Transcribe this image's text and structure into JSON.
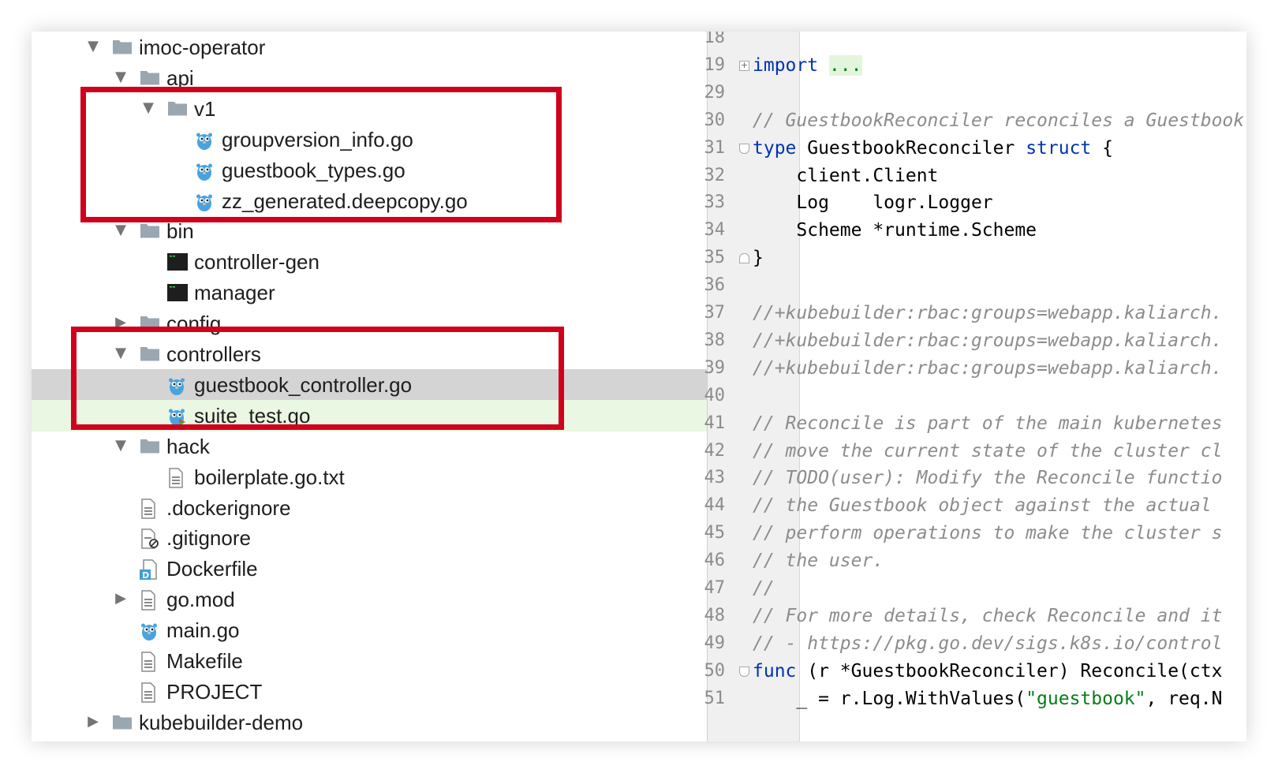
{
  "project_tree": [
    {
      "label": "imoc-operator",
      "indent": 0,
      "arrow": "▼",
      "icon": "folder-icon"
    },
    {
      "label": "api",
      "indent": 1,
      "arrow": "▼",
      "icon": "folder-icon"
    },
    {
      "label": "v1",
      "indent": 2,
      "arrow": "▼",
      "icon": "folder-icon"
    },
    {
      "label": "groupversion_info.go",
      "indent": 3,
      "arrow": "",
      "icon": "gopher-icon"
    },
    {
      "label": "guestbook_types.go",
      "indent": 3,
      "arrow": "",
      "icon": "gopher-icon"
    },
    {
      "label": "zz_generated.deepcopy.go",
      "indent": 3,
      "arrow": "",
      "icon": "gopher-icon"
    },
    {
      "label": "bin",
      "indent": 1,
      "arrow": "▼",
      "icon": "folder-icon"
    },
    {
      "label": "controller-gen",
      "indent": 2,
      "arrow": "",
      "icon": "executable-icon"
    },
    {
      "label": "manager",
      "indent": 2,
      "arrow": "",
      "icon": "executable-icon"
    },
    {
      "label": "config",
      "indent": 1,
      "arrow": "▶",
      "icon": "folder-icon"
    },
    {
      "label": "controllers",
      "indent": 1,
      "arrow": "▼",
      "icon": "folder-icon"
    },
    {
      "label": "guestbook_controller.go",
      "indent": 2,
      "arrow": "",
      "icon": "gopher-icon",
      "state": "selected"
    },
    {
      "label": "suite_test.go",
      "indent": 2,
      "arrow": "",
      "icon": "gopher-test-icon",
      "state": "modified"
    },
    {
      "label": "hack",
      "indent": 1,
      "arrow": "▼",
      "icon": "folder-icon"
    },
    {
      "label": "boilerplate.go.txt",
      "indent": 2,
      "arrow": "",
      "icon": "text-file-icon"
    },
    {
      "label": ".dockerignore",
      "indent": 1,
      "arrow": "",
      "icon": "text-file-icon"
    },
    {
      "label": ".gitignore",
      "indent": 1,
      "arrow": "",
      "icon": "ignore-file-icon"
    },
    {
      "label": "Dockerfile",
      "indent": 1,
      "arrow": "",
      "icon": "docker-file-icon"
    },
    {
      "label": "go.mod",
      "indent": 1,
      "arrow": "▶",
      "icon": "text-file-icon"
    },
    {
      "label": "main.go",
      "indent": 1,
      "arrow": "",
      "icon": "gopher-icon"
    },
    {
      "label": "Makefile",
      "indent": 1,
      "arrow": "",
      "icon": "text-file-icon"
    },
    {
      "label": "PROJECT",
      "indent": 1,
      "arrow": "",
      "icon": "text-file-icon"
    },
    {
      "label": "kubebuilder-demo",
      "indent": 0,
      "arrow": "▶",
      "icon": "folder-icon"
    }
  ],
  "editor": {
    "lines": [
      {
        "num": "18",
        "tokens": []
      },
      {
        "num": "19",
        "fold": "plus",
        "tokens": [
          {
            "t": "import",
            "c": "kw"
          },
          {
            "t": " "
          },
          {
            "t": "...",
            "c": "dots"
          }
        ]
      },
      {
        "num": "29",
        "tokens": []
      },
      {
        "num": "30",
        "tokens": [
          {
            "t": "// GuestbookReconciler reconciles a Guestbook object",
            "c": "cm"
          }
        ]
      },
      {
        "num": "31",
        "fold": "open",
        "tokens": [
          {
            "t": "type",
            "c": "kw"
          },
          {
            "t": " GuestbookReconciler "
          },
          {
            "t": "struct",
            "c": "kw"
          },
          {
            "t": " {"
          }
        ]
      },
      {
        "num": "32",
        "tokens": [
          {
            "t": "    client.Client"
          }
        ]
      },
      {
        "num": "33",
        "tokens": [
          {
            "t": "    Log    logr.Logger"
          }
        ]
      },
      {
        "num": "34",
        "tokens": [
          {
            "t": "    Scheme *runtime.Scheme"
          }
        ]
      },
      {
        "num": "35",
        "fold": "close",
        "tokens": [
          {
            "t": "}"
          }
        ]
      },
      {
        "num": "36",
        "tokens": []
      },
      {
        "num": "37",
        "tokens": [
          {
            "t": "//+kubebuilder:rbac:groups=webapp.kaliarch.",
            "c": "cm"
          }
        ]
      },
      {
        "num": "38",
        "tokens": [
          {
            "t": "//+kubebuilder:rbac:groups=webapp.kaliarch.",
            "c": "cm"
          }
        ]
      },
      {
        "num": "39",
        "tokens": [
          {
            "t": "//+kubebuilder:rbac:groups=webapp.kaliarch.",
            "c": "cm"
          }
        ]
      },
      {
        "num": "40",
        "tokens": []
      },
      {
        "num": "41",
        "tokens": [
          {
            "t": "// Reconcile is part of the main kubernetes",
            "c": "cm"
          }
        ]
      },
      {
        "num": "42",
        "tokens": [
          {
            "t": "// move the current state of the cluster cl",
            "c": "cm"
          }
        ]
      },
      {
        "num": "43",
        "tokens": [
          {
            "t": "// TODO(user): Modify the Reconcile functio",
            "c": "cm"
          }
        ]
      },
      {
        "num": "44",
        "tokens": [
          {
            "t": "// the Guestbook object against the actual",
            "c": "cm"
          }
        ]
      },
      {
        "num": "45",
        "tokens": [
          {
            "t": "// perform operations to make the cluster s",
            "c": "cm"
          }
        ]
      },
      {
        "num": "46",
        "tokens": [
          {
            "t": "// the user.",
            "c": "cm"
          }
        ]
      },
      {
        "num": "47",
        "tokens": [
          {
            "t": "//",
            "c": "cm"
          }
        ]
      },
      {
        "num": "48",
        "tokens": [
          {
            "t": "// For more details, check Reconcile and it",
            "c": "cm"
          }
        ]
      },
      {
        "num": "49",
        "tokens": [
          {
            "t": "// - https://pkg.go.dev/sigs.k8s.io/control",
            "c": "cm"
          }
        ]
      },
      {
        "num": "50",
        "fold": "open",
        "tokens": [
          {
            "t": "func",
            "c": "kw"
          },
          {
            "t": " (r *GuestbookReconciler) Reconcile(ctx"
          }
        ]
      },
      {
        "num": "51",
        "tokens": [
          {
            "t": "    _ = r.Log.WithValues("
          },
          {
            "t": "\"guestbook\"",
            "c": "st"
          },
          {
            "t": ", req.N"
          }
        ]
      }
    ]
  },
  "colors": {
    "highlight_box": "#d0021b",
    "keyword": "#0033b3",
    "comment": "#8c8c8c",
    "string": "#067d17",
    "selected_row": "#d4d4d4",
    "modified_row": "#eaf7e3"
  }
}
